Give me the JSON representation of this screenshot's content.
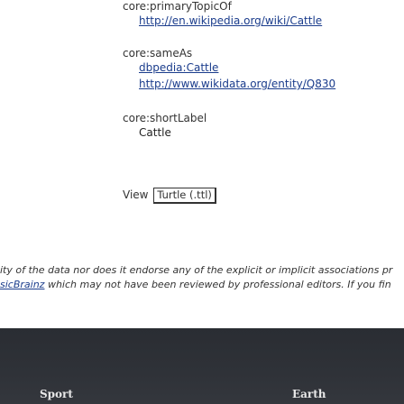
{
  "properties": [
    {
      "label": "core:primaryTopicOf",
      "values": [
        {
          "text": "http://en.wikipedia.org/wiki/Cattle",
          "link": true
        }
      ]
    },
    {
      "label": "core:sameAs",
      "values": [
        {
          "text": "dbpedia:Cattle",
          "link": true
        },
        {
          "text": "http://www.wikidata.org/entity/Q830",
          "link": true
        }
      ]
    },
    {
      "label": "core:shortLabel",
      "values": [
        {
          "text": "Cattle",
          "link": false
        }
      ]
    }
  ],
  "view": {
    "label": "View",
    "selected": "Turtle (.ttl)"
  },
  "disclaimer": {
    "line1": "ity of the data nor does it endorse any of the explicit or implicit associations pr",
    "line2_link": "sicBrainz",
    "line2_rest": " which may not have been reviewed by professional editors. If you fin"
  },
  "footer": {
    "items": [
      "Sport",
      "Earth"
    ]
  }
}
